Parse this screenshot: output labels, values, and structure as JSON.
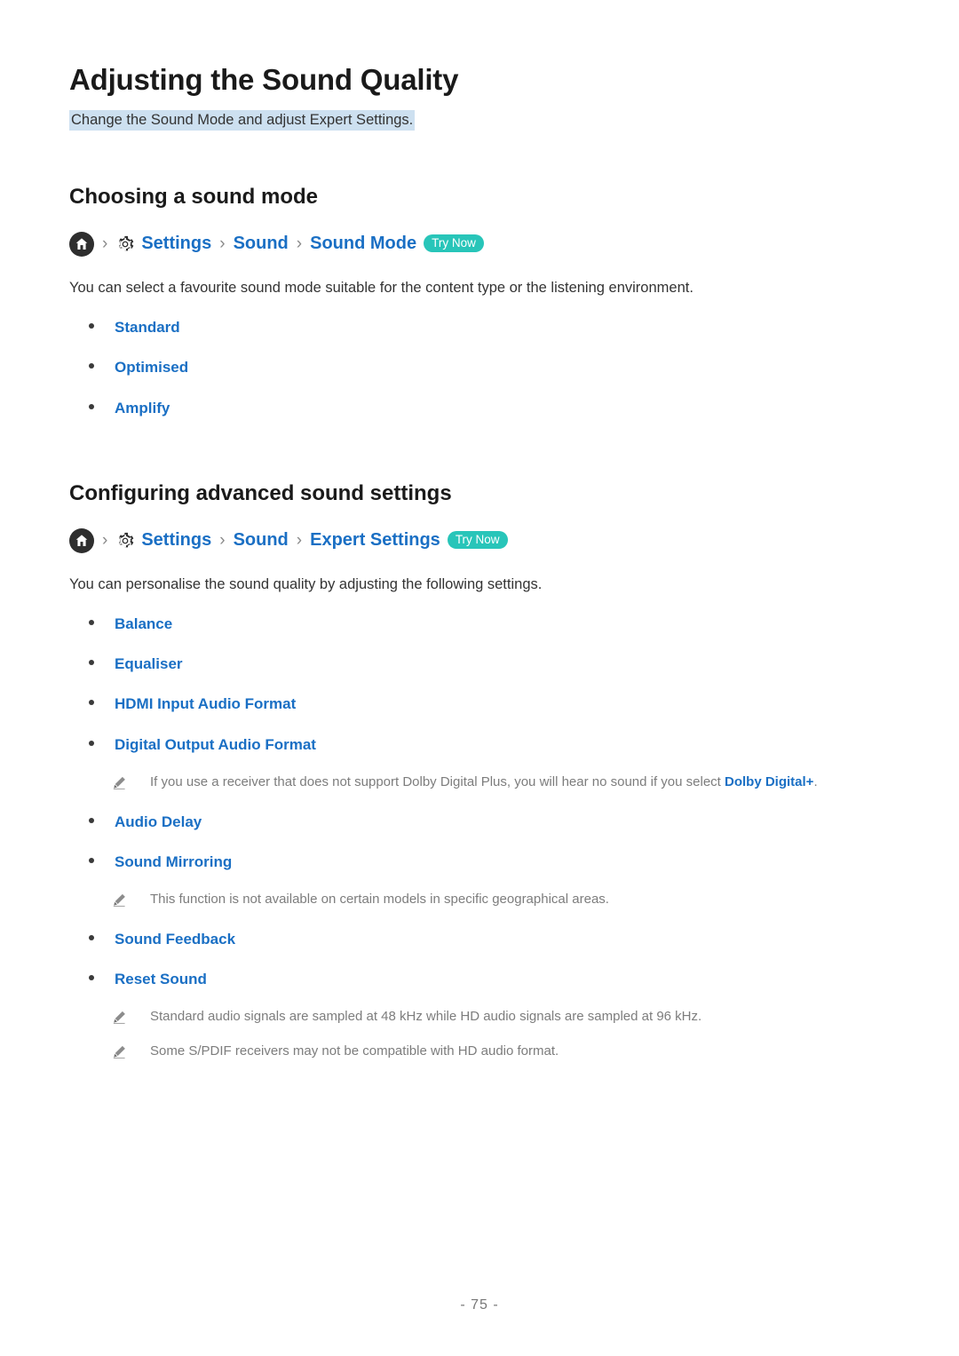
{
  "document": {
    "title": "Adjusting the Sound Quality",
    "subtitle": "Change the Sound Mode and adjust Expert Settings.",
    "page_number": "- 75 -"
  },
  "colors": {
    "link_blue": "#1a6fc4",
    "highlight_blue": "#cde0f0",
    "badge_teal": "#28c5b9",
    "note_gray": "#7d7d7d",
    "home_icon_dark": "#2e2e2e"
  },
  "sections": [
    {
      "heading": "Choosing a sound mode",
      "breadcrumb": {
        "home_icon": "home-icon",
        "gear_icon": "gear-icon",
        "separator": "›",
        "items": [
          "Settings",
          "Sound",
          "Sound Mode"
        ],
        "badge": "Try Now"
      },
      "intro": "You can select a favourite sound mode suitable for the content type or the listening environment.",
      "items": [
        {
          "label": "Standard",
          "notes": []
        },
        {
          "label": "Optimised",
          "notes": []
        },
        {
          "label": "Amplify",
          "notes": []
        }
      ],
      "trailing_notes": []
    },
    {
      "heading": "Configuring advanced sound settings",
      "breadcrumb": {
        "home_icon": "home-icon",
        "gear_icon": "gear-icon",
        "separator": "›",
        "items": [
          "Settings",
          "Sound",
          "Expert Settings"
        ],
        "badge": "Try Now"
      },
      "intro": "You can personalise the sound quality by adjusting the following settings.",
      "items": [
        {
          "label": "Balance",
          "notes": []
        },
        {
          "label": "Equaliser",
          "notes": []
        },
        {
          "label": "HDMI Input Audio Format",
          "notes": []
        },
        {
          "label": "Digital Output Audio Format",
          "notes": [
            {
              "icon": "pencil-icon",
              "text_before": "If you use a receiver that does not support Dolby Digital Plus, you will hear no sound if you select ",
              "accent": "Dolby Digital+",
              "text_after": "."
            }
          ]
        },
        {
          "label": "Audio Delay",
          "notes": []
        },
        {
          "label": "Sound Mirroring",
          "notes": [
            {
              "icon": "pencil-icon",
              "text_before": "This function is not available on certain models in specific geographical areas.",
              "accent": "",
              "text_after": ""
            }
          ]
        },
        {
          "label": "Sound Feedback",
          "notes": []
        },
        {
          "label": "Reset Sound",
          "notes": []
        }
      ],
      "trailing_notes": [
        {
          "icon": "pencil-icon",
          "text_before": "Standard audio signals are sampled at 48 kHz while HD audio signals are sampled at 96 kHz.",
          "accent": "",
          "text_after": ""
        },
        {
          "icon": "pencil-icon",
          "text_before": "Some S/PDIF receivers may not be compatible with HD audio format.",
          "accent": "",
          "text_after": ""
        }
      ]
    }
  ]
}
